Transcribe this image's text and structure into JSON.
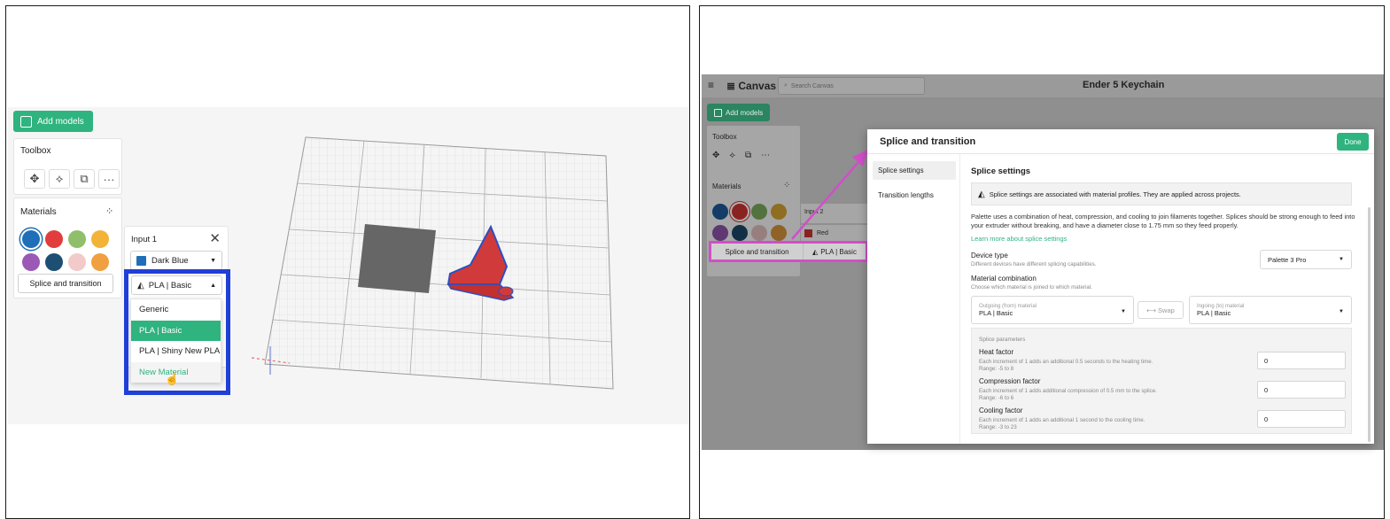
{
  "left": {
    "add_models_label": "Add models",
    "toolbox_title": "Toolbox",
    "tools": [
      "✥",
      "⟡",
      "⧉",
      "···"
    ],
    "materials_title": "Materials",
    "materials_icon": "grid-icon",
    "swatches": [
      "#1f6fb8",
      "#e23d3d",
      "#8fbf6a",
      "#f2b338",
      "#9b59b6",
      "#1d4f73",
      "#f2caca",
      "#f0a040"
    ],
    "splice_button": "Splice and transition",
    "input_card": {
      "title": "Input 1",
      "color_label": "Dark Blue",
      "color_swatch": "#1f6fb8",
      "material_selected": "PLA | Basic"
    },
    "menu_items": [
      "Generic",
      "PLA | Basic",
      "PLA | Shiny New PLA",
      "New Material"
    ],
    "highlight_color": "#1f3fd6"
  },
  "right": {
    "app_name": "Canvas",
    "search_placeholder": "Search Canvas",
    "project_title": "Ender 5 Keychain",
    "add_models_label": "Add models",
    "toolbox_title": "Toolbox",
    "materials_title": "Materials",
    "input_label": "Input 2",
    "red_label": "Red",
    "splice_button": "Splice and transition",
    "material_label": "PLA | Basic",
    "highlight_color": "#d04fc9",
    "modal": {
      "title": "Splice and transition",
      "done": "Done",
      "nav": [
        "Splice settings",
        "Transition lengths"
      ],
      "section_title": "Splice settings",
      "info": "Splice settings are associated with material profiles. They are applied across projects.",
      "paragraph": "Palette uses a combination of heat, compression, and cooling to join filaments together. Splices should be strong enough to feed into your extruder without breaking, and have a diameter close to 1.75 mm so they feed properly.",
      "learn_more": "Learn more about splice settings",
      "device_type_label": "Device type",
      "device_type_sub": "Different devices have different splicing capabilities.",
      "device_value": "Palette 3 Pro",
      "combo_label": "Material combination",
      "combo_sub": "Choose which material is joined to which material.",
      "outgoing_label": "Outgoing (from) material",
      "outgoing_value": "PLA | Basic",
      "swap_label": "Swap",
      "ingoing_label": "Ingoing (to) material",
      "ingoing_value": "PLA | Basic",
      "params_title": "Splice parameters",
      "params": [
        {
          "name": "Heat factor",
          "desc": "Each increment of 1 adds an additional 0.5 seconds to the heating time.",
          "range": "Range: -5 to 8",
          "value": "0"
        },
        {
          "name": "Compression factor",
          "desc": "Each increment of 1 adds additional compression of 0.5 mm to the splice.",
          "range": "Range: -6 to 6",
          "value": "0"
        },
        {
          "name": "Cooling factor",
          "desc": "Each increment of 1 adds an additional 1 second to the cooling time.",
          "range": "Range: -3 to 23",
          "value": "0"
        }
      ]
    }
  }
}
